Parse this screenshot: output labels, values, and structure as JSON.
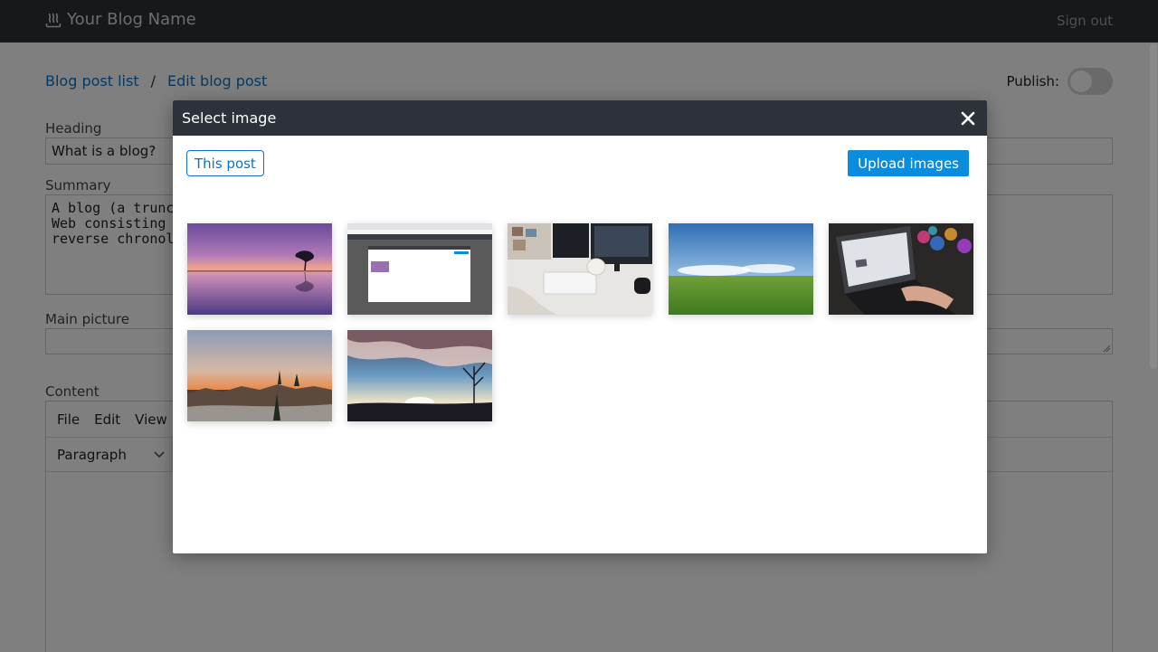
{
  "header": {
    "brand_name": "Your Blog Name",
    "brand_icon": "steam-icon",
    "sign_out": "Sign out"
  },
  "breadcrumb": {
    "items": [
      "Blog post list",
      "Edit blog post"
    ],
    "separator": "/"
  },
  "publish": {
    "label": "Publish:",
    "state": "off"
  },
  "form": {
    "heading_label": "Heading",
    "heading_value": "What is a blog?",
    "summary_label": "Summary",
    "summary_lines": [
      "A blog (a truncation",
      "Web consisting of d",
      "reverse chronologic"
    ],
    "main_picture_label": "Main picture",
    "main_picture_value": "",
    "content_label": "Content"
  },
  "editor": {
    "menu": [
      "File",
      "Edit",
      "View"
    ],
    "format_select": "Paragraph"
  },
  "modal": {
    "title": "Select image",
    "filter_button": "This post",
    "upload_button": "Upload images",
    "images": [
      "purple-lake-sunset-tree",
      "browser-screenshot",
      "desk-keyboard-monitors",
      "green-field-blue-sky",
      "laptop-typing-bokeh",
      "winter-sunset-forest",
      "cloudy-sunset-silhouette-trees"
    ]
  },
  "colors": {
    "topbar_bg": "#2d3139",
    "link": "#0a73c7",
    "primary_button": "#0a8ddd"
  }
}
